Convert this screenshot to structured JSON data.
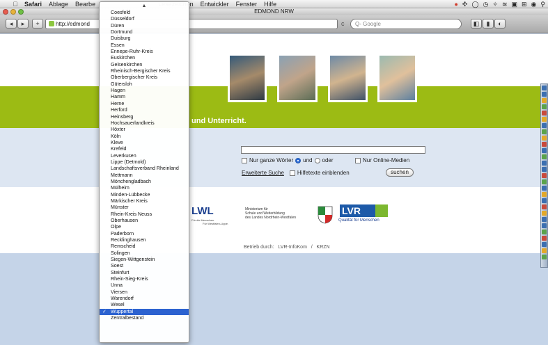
{
  "menubar": {
    "apple": "",
    "items": [
      "Safari",
      "Ablage",
      "Bearbe",
      "Lesezeichen",
      "Entwickler",
      "Fenster",
      "Hilfe"
    ],
    "status_icons": [
      "battery-icon",
      "bluetooth-icon",
      "timemachine-icon",
      "clock-icon",
      "sync-icon",
      "wifi-icon",
      "display-icon",
      "input-icon",
      "user-icon",
      "spotlight-icon"
    ]
  },
  "window": {
    "title": "EDMOND NRW",
    "address": "http://edmond",
    "search_placeholder": "Q- Google",
    "reload": "c"
  },
  "page": {
    "slogan": "und Unterricht.",
    "options": {
      "whole_words": "Nur ganze Wörter",
      "and": "und",
      "or": "oder",
      "online_media": "Nur Online-Medien",
      "advanced": "Erweiterte Suche",
      "help": "Hilfetexte einblenden",
      "search_button": "suchen"
    },
    "logos": {
      "lwl": "LWL",
      "lwl_sub1": "Für die Menschen.",
      "lwl_sub2": "Für Westfalen-Lippe.",
      "ministry": "Ministerium für\nSchule und Weiterbildung\ndes Landes Nordrhein-Westfalen",
      "lvr": "LVR",
      "lvr_sub": "Qualität für Menschen"
    },
    "betrieb": "Betrieb durch:   LVR-InfoKom   /   KRZN"
  },
  "dropdown": {
    "up_arrow": "▲",
    "selected": "Wuppertal",
    "items": [
      "Coesfeld",
      "Düsseldorf",
      "Düren",
      "Dortmund",
      "Duisburg",
      "Essen",
      "Ennepe-Ruhr-Kreis",
      "Euskirchen",
      "Gelsenkirchen",
      "Rheinisch-Bergischer Kreis",
      "Oberbergischer Kreis",
      "Gütersloh",
      "Hagen",
      "Hamm",
      "Herne",
      "Herford",
      "Heinsberg",
      "Hochsauerlandkreis",
      "Höxter",
      "Köln",
      "Kleve",
      "Krefeld",
      "Leverkusen",
      "Lippe (Detmold)",
      "Landschaftsverband Rheinland",
      "Mettmann",
      "Mönchengladbach",
      "Mülheim",
      "Minden-Lübbecke",
      "Märkischer Kreis",
      "Münster",
      "Rhein-Kreis Neuss",
      "Oberhausen",
      "Olpe",
      "Paderborn",
      "Recklinghausen",
      "Remscheid",
      "Solingen",
      "Siegen-Wittgenstein",
      "Soest",
      "Steinfurt",
      "Rhein-Sieg-Kreis",
      "Unna",
      "Viersen",
      "Warendorf",
      "Wesel",
      "Wuppertal",
      "Zentralbestand"
    ]
  },
  "colors": {
    "green_band": "#9cbb14",
    "selection": "#2c62d0",
    "page_bg": "#c5d4e8"
  }
}
